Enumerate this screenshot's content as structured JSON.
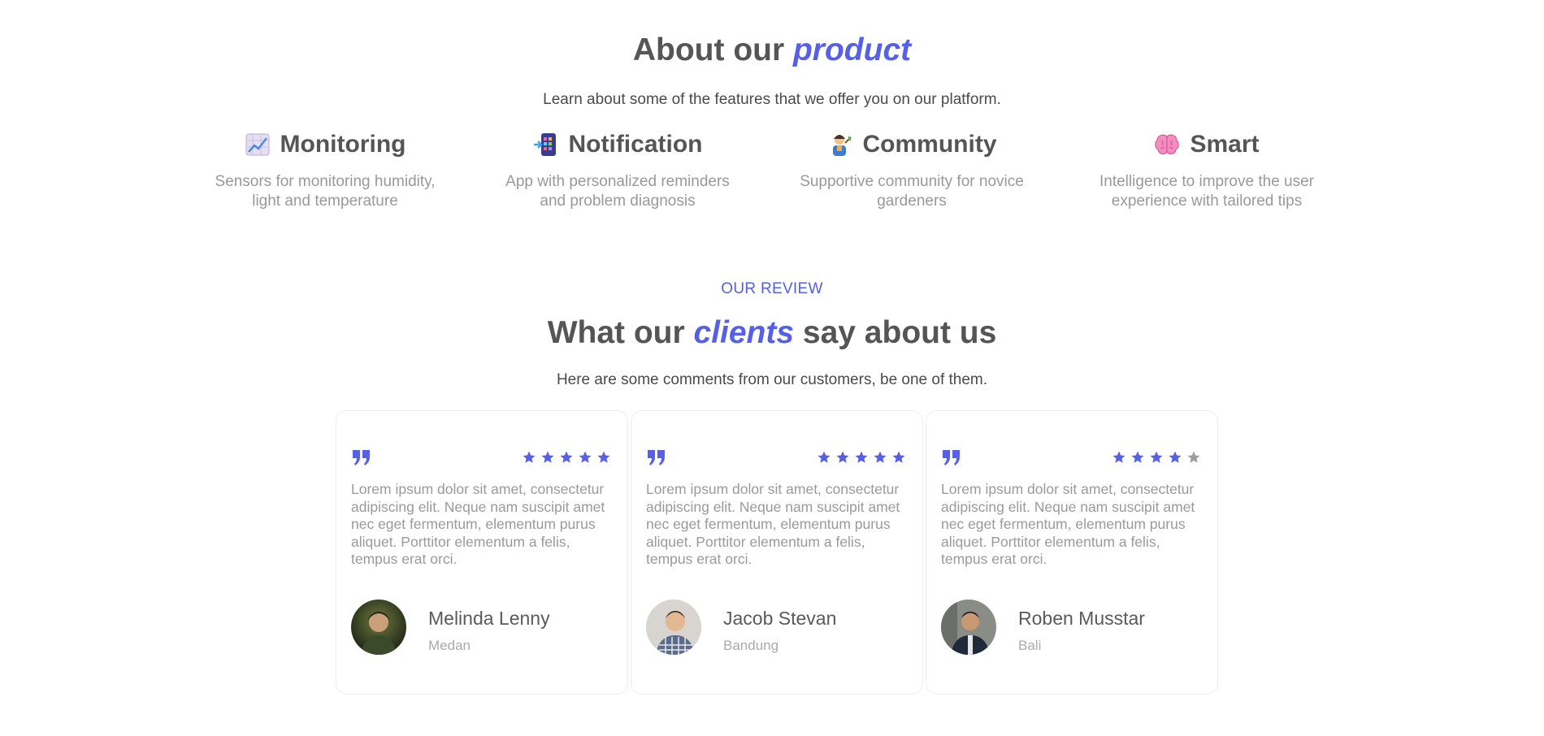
{
  "about": {
    "title_plain": "About our ",
    "title_accent": "product",
    "subtitle": "Learn about some of the features that we offer you on our platform."
  },
  "features": [
    {
      "icon": "chart-increasing-icon",
      "title": "Monitoring",
      "desc_line1": "Sensors for monitoring humidity,",
      "desc_line2": "light and temperature"
    },
    {
      "icon": "mobile-phone-arrow-icon",
      "title": "Notification",
      "desc_line1": "App with personalized reminders",
      "desc_line2": "and problem diagnosis"
    },
    {
      "icon": "farmer-icon",
      "title": "Community",
      "desc_line1": "Supportive community for novice",
      "desc_line2": "gardeners"
    },
    {
      "icon": "brain-icon",
      "title": "Smart",
      "desc_line1": "Intelligence to improve the user",
      "desc_line2": "experience with tailored tips"
    }
  ],
  "reviews": {
    "eyebrow": "OUR REVIEW",
    "title_plain1": "What our ",
    "title_accent": "clients",
    "title_plain2": " say about us",
    "subtitle": "Here are some comments from our customers, be one of them.",
    "items": [
      {
        "text": "Lorem ipsum dolor sit amet, consectetur adipiscing elit. Neque nam suscipit amet nec eget fermentum, elementum purus aliquet. Porttitor elementum a felis, tempus erat orci.",
        "name": "Melinda Lenny",
        "city": "Medan",
        "rating": 5
      },
      {
        "text": "Lorem ipsum dolor sit amet, consectetur adipiscing elit. Neque nam suscipit amet nec eget fermentum, elementum purus aliquet. Porttitor elementum a felis, tempus erat orci.",
        "name": "Jacob Stevan",
        "city": "Bandung",
        "rating": 5
      },
      {
        "text": "Lorem ipsum dolor sit amet, consectetur adipiscing elit. Neque nam suscipit amet nec eget fermentum, elementum purus aliquet. Porttitor elementum a felis, tempus erat orci.",
        "name": "Roben Musstar",
        "city": "Bali",
        "rating": 4
      }
    ]
  },
  "colors": {
    "accent": "#5560e6",
    "heading": "#555555",
    "muted": "#999999",
    "star_off": "#9e9e9e"
  }
}
